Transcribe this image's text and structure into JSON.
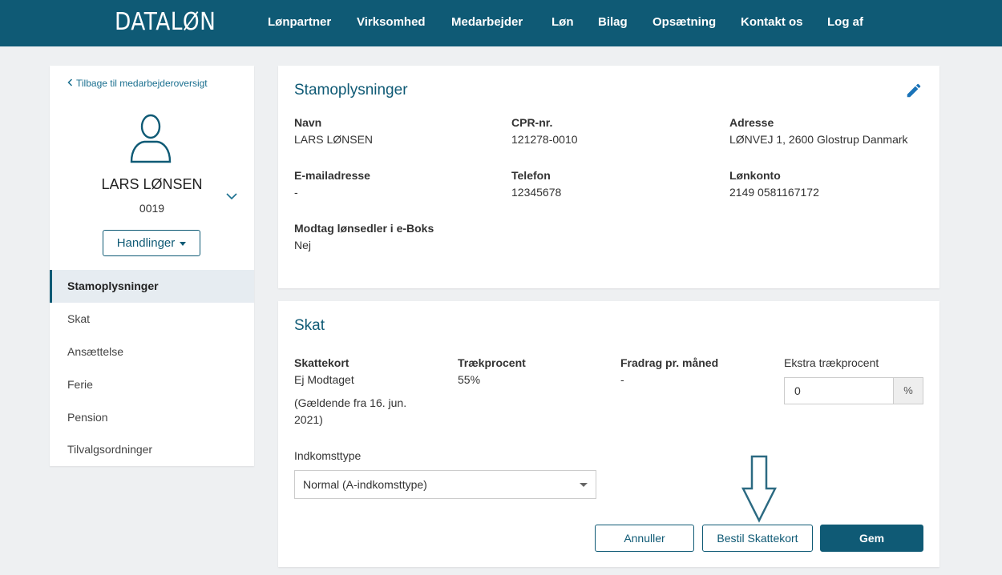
{
  "brand": {
    "logo": "DATALØN",
    "accent": "#0f5a75"
  },
  "nav": [
    "Lønpartner",
    "Virksomhed",
    "Medarbejder",
    "Løn",
    "Bilag",
    "Opsætning",
    "Kontakt os",
    "Log af"
  ],
  "sidebar": {
    "back_link": "Tilbage til medarbejderoversigt",
    "employee_name": "LARS LØNSEN",
    "employee_number": "0019",
    "actions_label": "Handlinger",
    "items": [
      "Stamoplysninger",
      "Skat",
      "Ansættelse",
      "Ferie",
      "Pension",
      "Tilvalgsordninger"
    ],
    "active_item": "Stamoplysninger"
  },
  "stamoplysninger": {
    "title": "Stamoplysninger",
    "fields": {
      "name": {
        "label": "Navn",
        "value": "LARS LØNSEN"
      },
      "cpr": {
        "label": "CPR-nr.",
        "value": "121278-0010"
      },
      "address": {
        "label": "Adresse",
        "value": "LØNVEJ 1, 2600 Glostrup Danmark"
      },
      "email": {
        "label": "E-mailadresse",
        "value": "-"
      },
      "phone": {
        "label": "Telefon",
        "value": "12345678"
      },
      "account": {
        "label": "Lønkonto",
        "value": "2149 0581167172"
      },
      "eboks": {
        "label": "Modtag lønsedler i e-Boks",
        "value": "Nej"
      }
    }
  },
  "skat": {
    "title": "Skat",
    "skattekort": {
      "label": "Skattekort",
      "value": "Ej Modtaget",
      "note_line1": "(Gældende fra 16. jun.",
      "note_line2": "2021)"
    },
    "traekprocent": {
      "label": "Trækprocent",
      "value": "55%"
    },
    "fradrag": {
      "label": "Fradrag pr. måned",
      "value": "-"
    },
    "ekstra": {
      "label": "Ekstra trækprocent",
      "value": "0",
      "addon": "%"
    },
    "indkomsttype": {
      "label": "Indkomsttype",
      "selected": "Normal (A-indkomsttype)"
    },
    "buttons": {
      "cancel": "Annuller",
      "order": "Bestil Skattekort",
      "save": "Gem"
    }
  }
}
